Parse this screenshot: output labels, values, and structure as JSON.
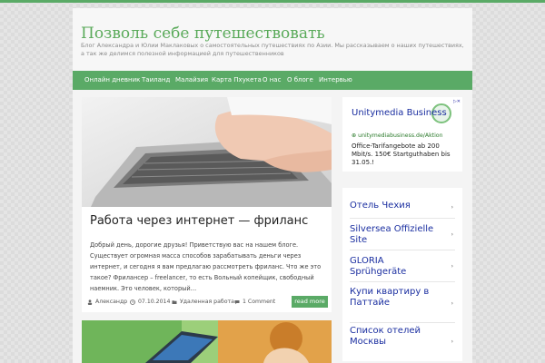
{
  "site": {
    "title": "Позволь себе путешествовать",
    "description": "Блог Александра и Юлии Маклаковых о самостоятельных путешествиях по Азии. Мы рассказываем о наших путешествиях, а так же делимся полезной информацией для путешественников"
  },
  "nav": {
    "items": [
      "Онлайн дневник",
      "Таиланд",
      "Малайзия",
      "Карта Пхукета",
      "О нас",
      "О блоге",
      "Интервью"
    ]
  },
  "post": {
    "title": "Работа через интернет — фриланс",
    "excerpt": "Добрый день, дорогие друзья! Приветствую вас на нашем блоге. Существует огромная масса способов зарабатывать деньги через интернет, и сегодня я вам предлагаю рассмотреть фриланс. Что же это такое? Фрилансер – freelancer, то есть Вольный копейщик, свободный наемник. Это человек, который…",
    "author": "Александр",
    "date": "07.10.2014",
    "category": "Удаленная работа",
    "comments": "1 Comment",
    "read_more": "read more"
  },
  "ad": {
    "title": "Unitymedia Business",
    "url": "unitymediabusiness.de/Aktion",
    "text": "Office-Tarifangebote ab 200 Mbit/s. 150€ Startguthaben bis 31.05.!"
  },
  "sidebar_links": [
    {
      "label": "Отель Чехия",
      "arrow": "›"
    },
    {
      "label": "Silversea Offizielle Site",
      "arrow": "›"
    },
    {
      "label": "GLORIA Sprühgeräte",
      "arrow": "›"
    },
    {
      "label": "Купи квартиру в Паттайе",
      "arrow": "›"
    },
    {
      "label": "Список отелей Москвы",
      "arrow": "›"
    }
  ],
  "colors": {
    "accent": "#5aaa66",
    "link": "#1a2ea0"
  }
}
